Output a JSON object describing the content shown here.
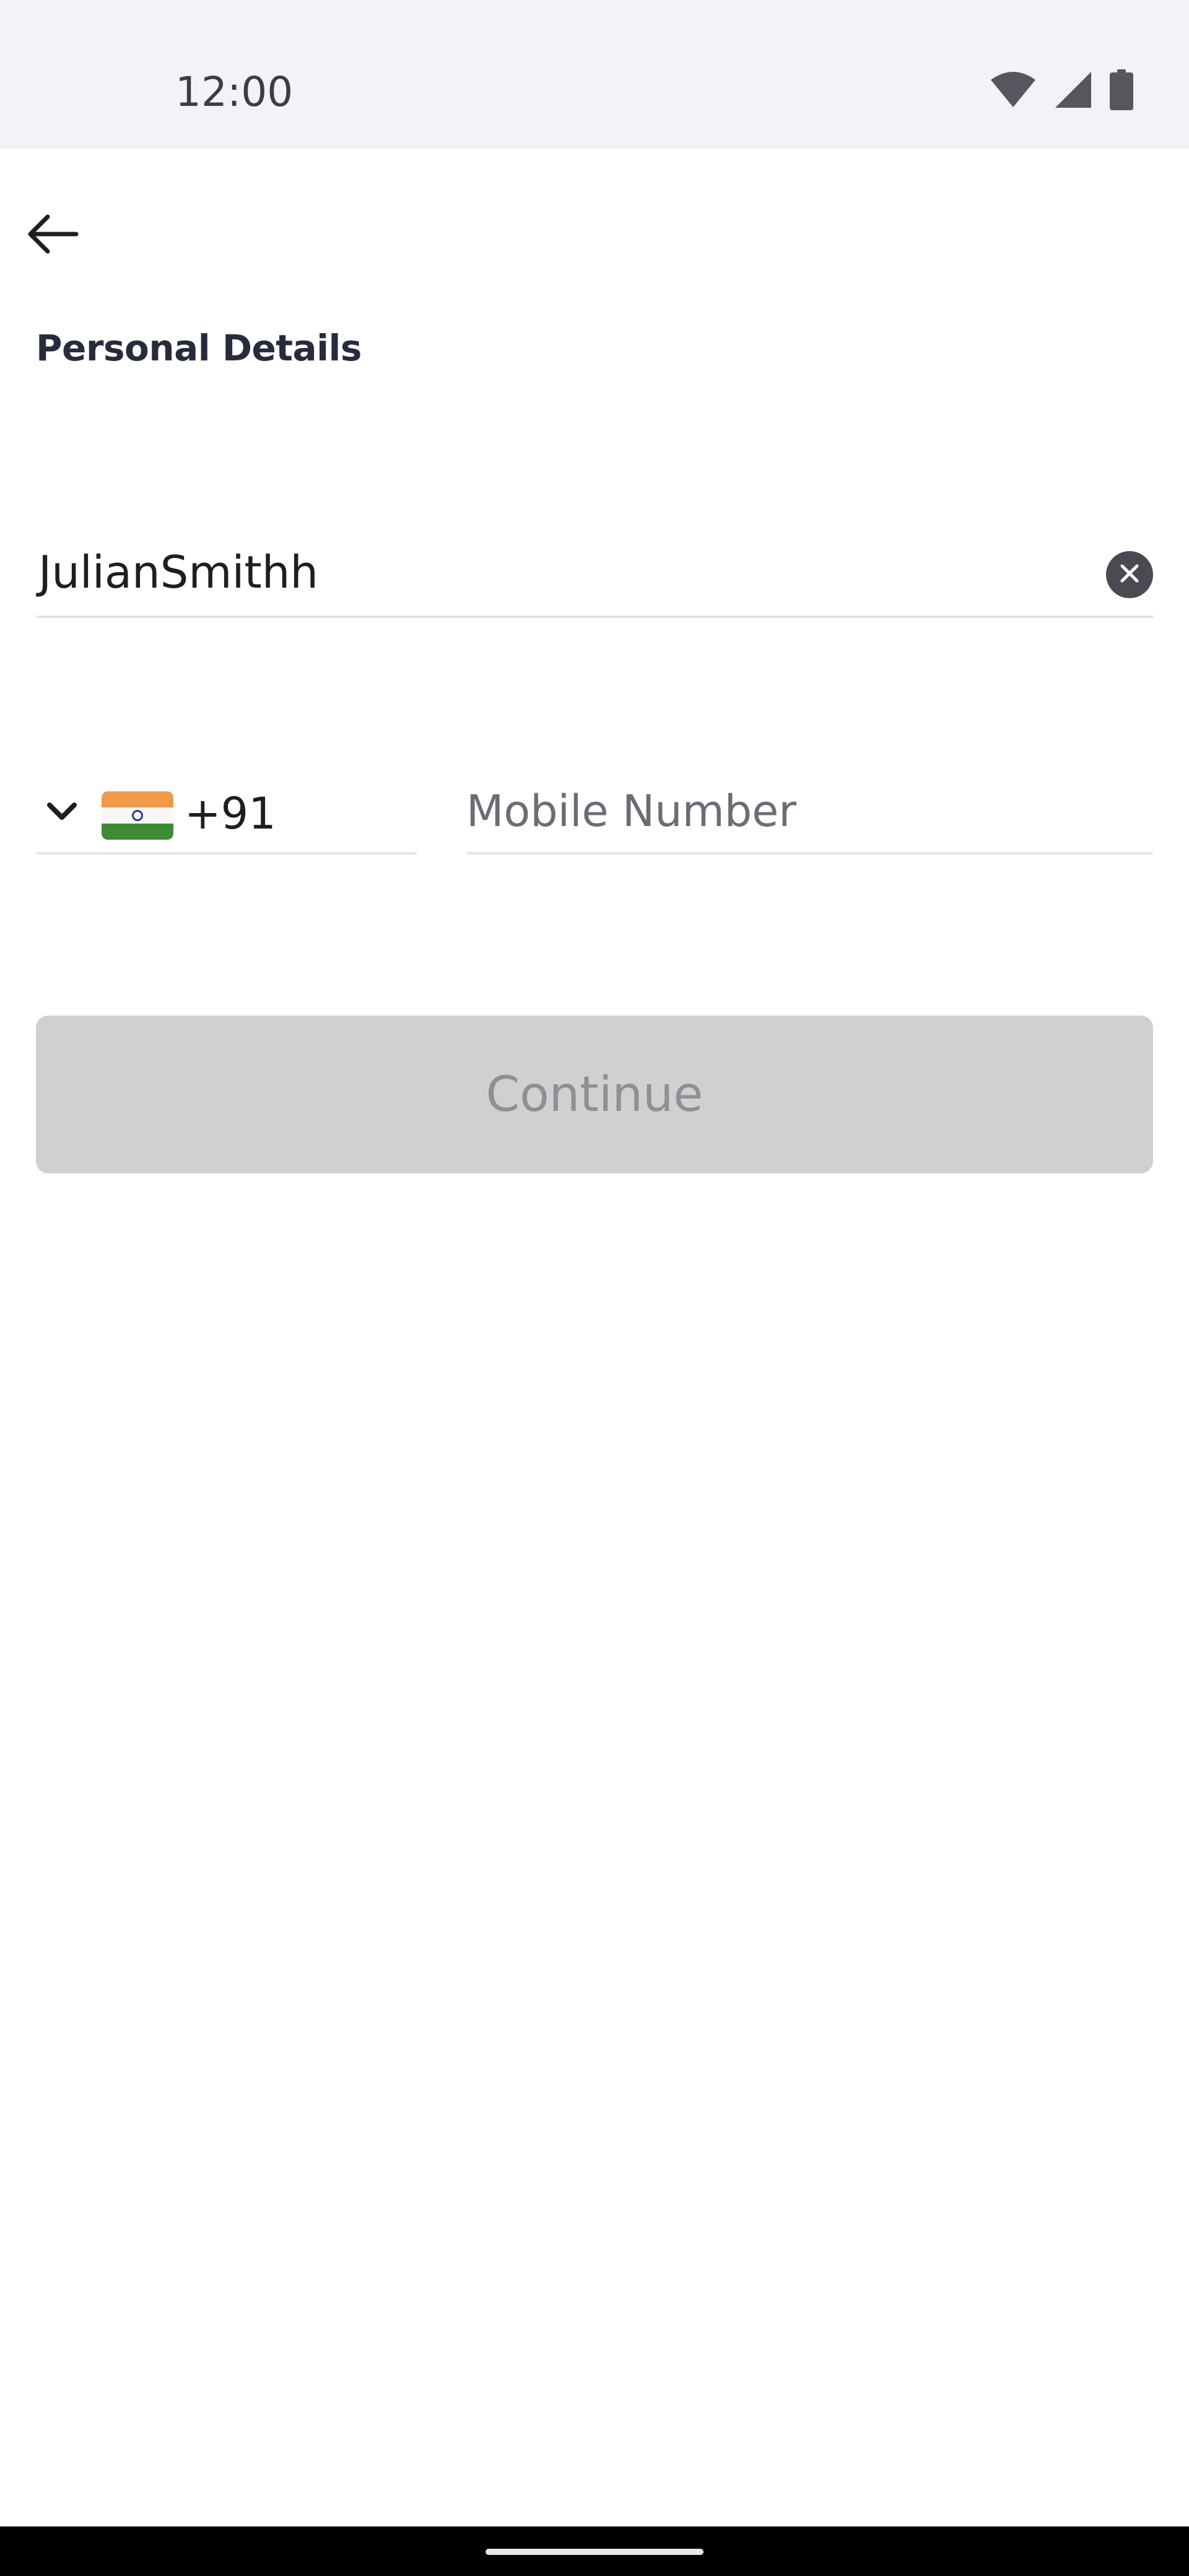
{
  "status_bar": {
    "time": "12:00",
    "icons": [
      "wifi-icon",
      "cellular-signal-icon",
      "battery-icon"
    ]
  },
  "app_bar": {
    "back_icon": "arrow-left-icon"
  },
  "page": {
    "title": "Personal Details"
  },
  "name_field": {
    "value": "JulianSmithh",
    "clear_icon": "clear-circle-icon"
  },
  "phone": {
    "dropdown_icon": "chevron-down-icon",
    "flag": "india-flag-icon",
    "dial_code": "+91",
    "placeholder": "Mobile Number",
    "value": ""
  },
  "actions": {
    "continue_label": "Continue",
    "continue_enabled": false
  },
  "colors": {
    "status_bar_bg": "#f2f3f7",
    "title_text": "#272c3d",
    "disabled_button_bg": "#d0d0d0",
    "disabled_button_text": "#8e8f97",
    "divider": "#e4e4e8"
  }
}
